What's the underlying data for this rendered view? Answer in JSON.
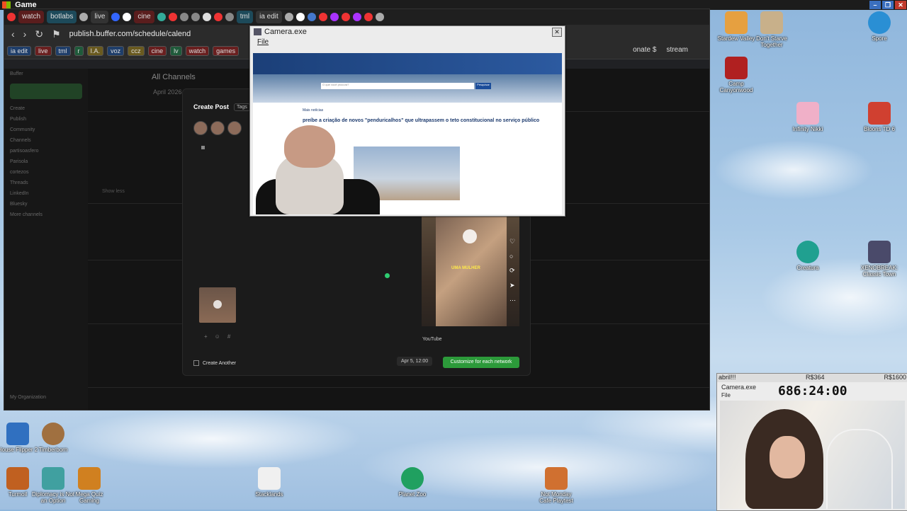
{
  "gamebar": {
    "title": "Game"
  },
  "browser": {
    "tabs": [
      "watch",
      "botlabs",
      "live",
      "cine",
      "tml",
      "ia edit"
    ],
    "url": "publish.buffer.com/schedule/calend",
    "bookmarks": [
      "ia edit",
      "live",
      "tml",
      "r",
      "I.A.",
      "voz",
      "ccz",
      "cine",
      "lv",
      "watch",
      "games"
    ],
    "bookmarks_right": [
      "onate $",
      "stream"
    ]
  },
  "buffer": {
    "sidebar": [
      "Buffer",
      "Create",
      "Publish",
      "Community",
      "Channels",
      "partisoasfero",
      "Parisola",
      "cortezos",
      "Threads",
      "LinkedIn",
      "Bluesky",
      "More channels",
      "My Organization"
    ],
    "header": "All Channels",
    "month": "April 2026",
    "show_less": "Show less"
  },
  "modal": {
    "title": "Create Post",
    "tags": "Tags",
    "create_another": "Create Another",
    "date": "Apr 5, 12:00",
    "customize": "Customize for each network",
    "preview_network": "YouTube",
    "preview_caption": "UMA MULHER"
  },
  "camera": {
    "title": "Camera.exe",
    "menu_file": "File",
    "headline": "preíbe a criação de novos \"penduricalhos\" que ultrapassem o teto constitucional no serviço público",
    "more_news": "Mais notícias",
    "search_placeholder": "O que você procura?",
    "search_btn": "Pesquisar"
  },
  "facecam": {
    "label_left": "abril!!!",
    "label_mid": "R$364",
    "label_right": "R$1600",
    "title": "Camera.exe",
    "timer": "686:24:00",
    "file": "File"
  },
  "desktop_icons": [
    {
      "label": "Stardew Valley",
      "color": "#e6a040"
    },
    {
      "label": "Don't Starve Together",
      "color": "#c8b08a"
    },
    {
      "label": "Spore",
      "color": "#2a8fd4"
    },
    {
      "label": "Camp Canyonwood",
      "color": "#b02020"
    },
    {
      "label": "Infinity Nikki",
      "color": "#f0b0c8"
    },
    {
      "label": "Bloons TD 6",
      "color": "#d04030"
    },
    {
      "label": "Creatura",
      "color": "#20a090"
    },
    {
      "label": "XENOBREAK: Classic Town",
      "color": "#4a4a6a"
    },
    {
      "label": "House Flipper 2",
      "color": "#3070c0"
    },
    {
      "label": "Timberborn",
      "color": "#a07040"
    },
    {
      "label": "Turmoil",
      "color": "#c06020"
    },
    {
      "label": "Diplomacy is Not an Option",
      "color": "#40a0a0"
    },
    {
      "label": "Mega Quiz Gaming",
      "color": "#d08020"
    },
    {
      "label": "Stacklands",
      "color": "#f0f0f0"
    },
    {
      "label": "Planet Zoo",
      "color": "#20a060"
    },
    {
      "label": "Not Monday Cafe Playtest",
      "color": "#d07030"
    }
  ]
}
